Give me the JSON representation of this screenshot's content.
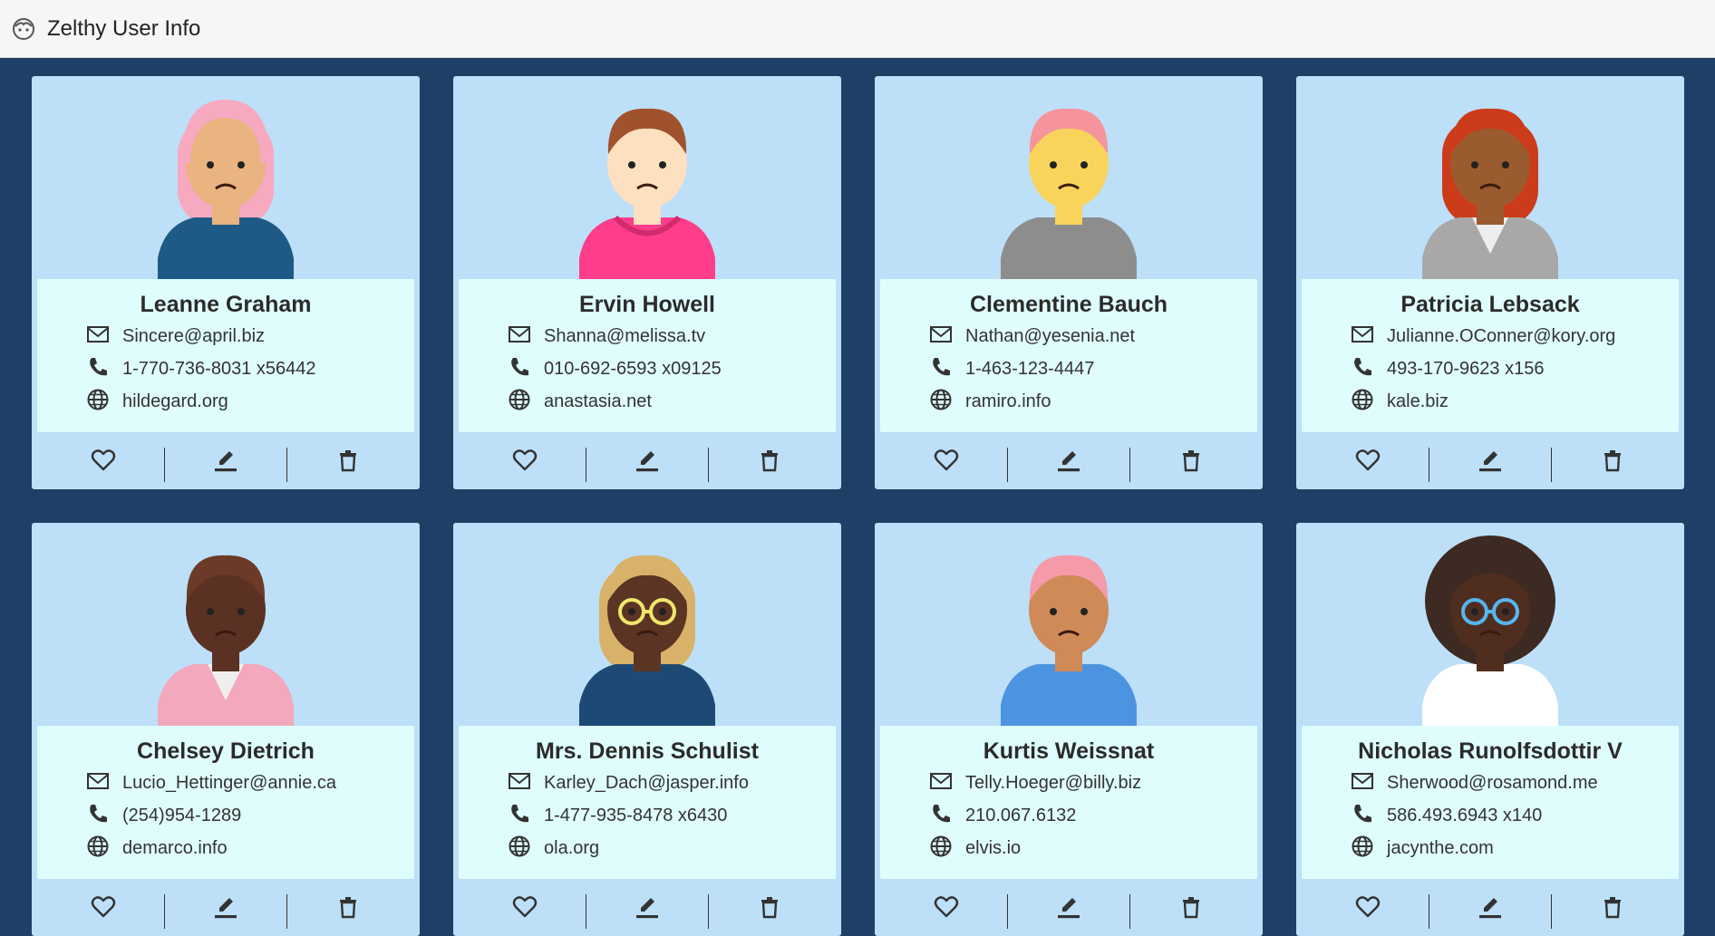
{
  "app": {
    "title": "Zelthy User Info",
    "logo_icon": "face-icon"
  },
  "colors": {
    "background": "#1f3f66",
    "card": "#bde0f8",
    "info_panel": "#e0fdfe"
  },
  "users": [
    {
      "name": "Leanne Graham",
      "email": "Sincere@april.biz",
      "phone": "1-770-736-8031 x56442",
      "website": "hildegard.org"
    },
    {
      "name": "Ervin Howell",
      "email": "Shanna@melissa.tv",
      "phone": "010-692-6593 x09125",
      "website": "anastasia.net"
    },
    {
      "name": "Clementine Bauch",
      "email": "Nathan@yesenia.net",
      "phone": "1-463-123-4447",
      "website": "ramiro.info"
    },
    {
      "name": "Patricia Lebsack",
      "email": "Julianne.OConner@kory.org",
      "phone": "493-170-9623 x156",
      "website": "kale.biz"
    },
    {
      "name": "Chelsey Dietrich",
      "email": "Lucio_Hettinger@annie.ca",
      "phone": "(254)954-1289",
      "website": "demarco.info"
    },
    {
      "name": "Mrs. Dennis Schulist",
      "email": "Karley_Dach@jasper.info",
      "phone": "1-477-935-8478 x6430",
      "website": "ola.org"
    },
    {
      "name": "Kurtis Weissnat",
      "email": "Telly.Hoeger@billy.biz",
      "phone": "210.067.6132",
      "website": "elvis.io"
    },
    {
      "name": "Nicholas Runolfsdottir V",
      "email": "Sherwood@rosamond.me",
      "phone": "586.493.6943 x140",
      "website": "jacynthe.com"
    }
  ],
  "card_actions": [
    "heart-icon",
    "edit-icon",
    "delete-icon"
  ]
}
